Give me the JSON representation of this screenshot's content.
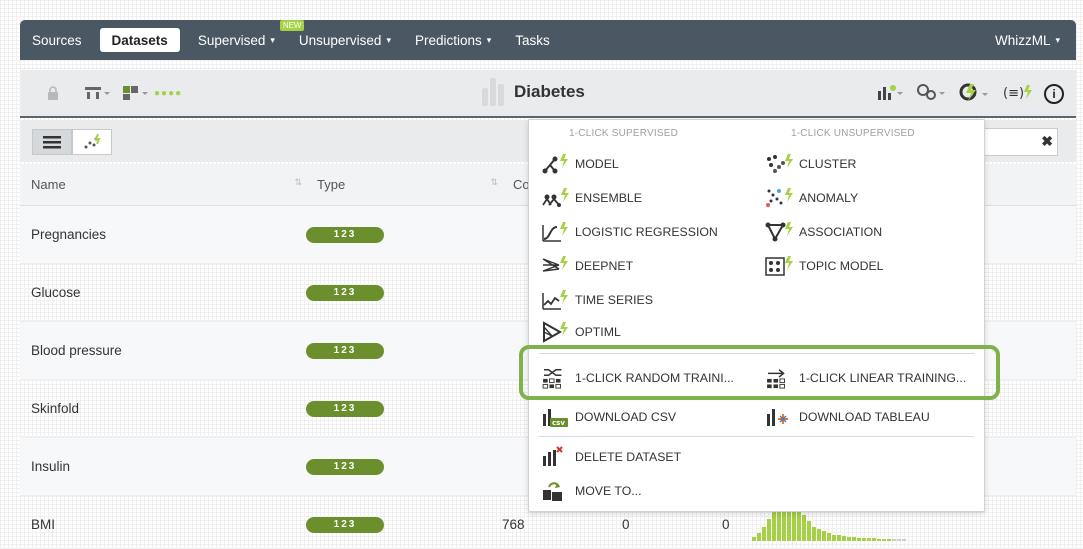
{
  "nav": {
    "items": [
      {
        "label": "Sources",
        "active": false,
        "caret": false
      },
      {
        "label": "Datasets",
        "active": true,
        "caret": false
      },
      {
        "label": "Supervised",
        "active": false,
        "caret": true
      },
      {
        "label": "Unsupervised",
        "active": false,
        "caret": true
      },
      {
        "label": "Predictions",
        "active": false,
        "caret": true
      },
      {
        "label": "Tasks",
        "active": false,
        "caret": false
      }
    ],
    "new_badge": "NEW",
    "right_label": "WhizzML",
    "caret_glyph": "▾"
  },
  "toolbar": {
    "title": "Diabetes",
    "dots": "●●●●",
    "info_glyph": "i",
    "icons": [
      "lock-icon",
      "tree-icon",
      "sort-icon",
      "chart-icon",
      "settings-icon",
      "oneclick-icon",
      "filter-icon",
      "info-icon"
    ]
  },
  "table": {
    "headers": {
      "name": "Name",
      "type": "Type",
      "count": "Count"
    },
    "rows": [
      {
        "name": "Pregnancies",
        "type": "123",
        "count": ""
      },
      {
        "name": "Glucose",
        "type": "123",
        "count": ""
      },
      {
        "name": "Blood pressure",
        "type": "123",
        "count": ""
      },
      {
        "name": "Skinfold",
        "type": "123",
        "count": ""
      },
      {
        "name": "Insulin",
        "type": "123",
        "count": ""
      },
      {
        "name": "BMI",
        "type": "123",
        "count": "768",
        "missing": "0",
        "errors": "0"
      }
    ]
  },
  "menu": {
    "supervised_heading": "1-CLICK SUPERVISED",
    "unsupervised_heading": "1-CLICK UNSUPERVISED",
    "left": [
      {
        "label": "MODEL",
        "icon": "model-icon"
      },
      {
        "label": "ENSEMBLE",
        "icon": "ensemble-icon"
      },
      {
        "label": "LOGISTIC REGRESSION",
        "icon": "logistic-icon"
      },
      {
        "label": "DEEPNET",
        "icon": "deepnet-icon"
      },
      {
        "label": "TIME SERIES",
        "icon": "timeseries-icon"
      },
      {
        "label": "OPTIML",
        "icon": "optiml-icon"
      }
    ],
    "right": [
      {
        "label": "CLUSTER",
        "icon": "cluster-icon"
      },
      {
        "label": "ANOMALY",
        "icon": "anomaly-icon"
      },
      {
        "label": "ASSOCIATION",
        "icon": "association-icon"
      },
      {
        "label": "TOPIC MODEL",
        "icon": "topic-model-icon"
      }
    ],
    "split_random": "1-CLICK RANDOM TRAINI...",
    "split_linear": "1-CLICK LINEAR TRAINING...",
    "download_csv": "DOWNLOAD CSV",
    "download_tableau": "DOWNLOAD TABLEAU",
    "delete": "DELETE DATASET",
    "move": "MOVE TO...",
    "highlight_color": "#7fb24a"
  },
  "colors": {
    "nav_bg": "#4b5763",
    "accent_green": "#a6d046",
    "type_badge": "#6b8f2c"
  }
}
